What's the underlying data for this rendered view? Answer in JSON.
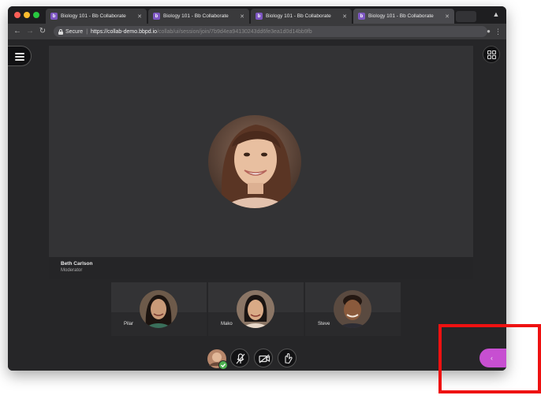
{
  "browser": {
    "tabs": [
      {
        "label": "Biology 101 - Bb Collaborate",
        "active": false
      },
      {
        "label": "Biology 101 - Bb Collaborate",
        "active": false
      },
      {
        "label": "Biology 101 - Bb Collaborate",
        "active": false
      },
      {
        "label": "Biology 101 - Bb Collaborate",
        "active": true
      }
    ],
    "address": {
      "secure_label": "Secure",
      "url_host": "https://collab-demo.bbpd.io",
      "url_path": "/collab/ui/session/join/7b9d4ea94130243dd6fe3ea1d0d14bb9fb"
    }
  },
  "session": {
    "speaker": {
      "name": "Beth Carlson",
      "role": "Moderator"
    },
    "participants": [
      {
        "name": "Pilar"
      },
      {
        "name": "Mako"
      },
      {
        "name": "Steve"
      }
    ]
  },
  "icons": {
    "menu": "hamburger-menu-icon",
    "layout": "grid-layout-icon",
    "mic": "microphone-muted-icon",
    "camera": "camera-off-icon",
    "hand": "raise-hand-icon",
    "panel": "chevron-left-icon",
    "status": "checkmark-icon"
  },
  "colors": {
    "accent": "#c74fd1",
    "highlight": "#ee1111",
    "status_ok": "#4caf50",
    "favicon": "#7e57c2"
  }
}
